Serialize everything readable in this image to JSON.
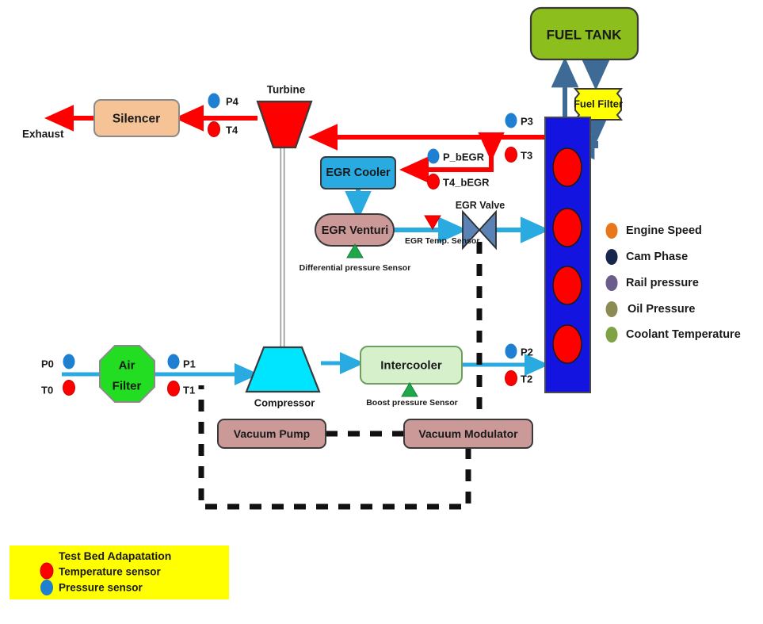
{
  "diagram": {
    "title": "Engine test bed air / exhaust / EGR / fuel schematic",
    "colors": {
      "air_flow": "#29ABE2",
      "exhaust_flow": "#FF0000",
      "fuel_flow": "#3D6B96",
      "vacuum_line": "#111111",
      "temperature_sensor": "#FF0000",
      "pressure_sensor": "#1F7FD0",
      "engine_block": "#1414E0",
      "cylinder": "#FF0000",
      "fuel_tank": "#8CBE1E",
      "fuel_filter": "#FFFF00",
      "egr_cooler": "#29ABE2",
      "egr_venturi": "#CC9999",
      "egr_valve": "#5A82B4",
      "turbine": "#FF0000",
      "compressor": "#00E5FF",
      "silencer": "#F5C396",
      "air_filter": "#22DD22",
      "intercooler": "#D6F0CC",
      "vacuum_box": "#CC9999",
      "legend_bg": "#FFFF00"
    }
  },
  "nodes": {
    "fuel_tank": "FUEL  TANK",
    "fuel_filter": "Fuel Filter",
    "silencer": "Silencer",
    "turbine": "Turbine",
    "compressor": "Compressor",
    "egr_cooler": "EGR Cooler",
    "egr_venturi": "EGR Venturi",
    "egr_valve": "EGR Valve",
    "air_filter_line1": "Air",
    "air_filter_line2": "Filter",
    "intercooler": "Intercooler",
    "vacuum_pump": "Vacuum Pump",
    "vacuum_modulator": "Vacuum Modulator"
  },
  "flow_labels": {
    "exhaust": "Exhaust"
  },
  "sensor_tags": {
    "p0": "P0",
    "t0": "T0",
    "p1": "P1",
    "t1": "T1",
    "p2": "P2",
    "t2": "T2",
    "p3": "P3",
    "t3": "T3",
    "p4": "P4",
    "t4": "T4",
    "p_begr": "P_bEGR",
    "t4_begr": "T4_bEGR"
  },
  "annotations": {
    "egr_temp_sensor": "EGR Temp. Sensor",
    "differential_pressure_sensor": "Differential pressure Sensor",
    "boost_pressure_sensor": "Boost pressure Sensor"
  },
  "ecu_legend": {
    "items": [
      {
        "label": "Engine Speed",
        "color": "#E8761A"
      },
      {
        "label": "Cam Phase",
        "color": "#17264B"
      },
      {
        "label": "Rail pressure",
        "color": "#6B5C8C"
      },
      {
        "label": "Oil Pressure",
        "color": "#8C8C52"
      },
      {
        "label": "Coolant Temperature",
        "color": "#7FA344"
      }
    ]
  },
  "testbed_legend": {
    "title": "Test Bed Adapatation",
    "items": [
      {
        "label": "Temperature sensor",
        "color": "#FF0000"
      },
      {
        "label": "Pressure sensor",
        "color": "#1F7FD0"
      }
    ]
  },
  "engine": {
    "cylinder_count": 4
  }
}
